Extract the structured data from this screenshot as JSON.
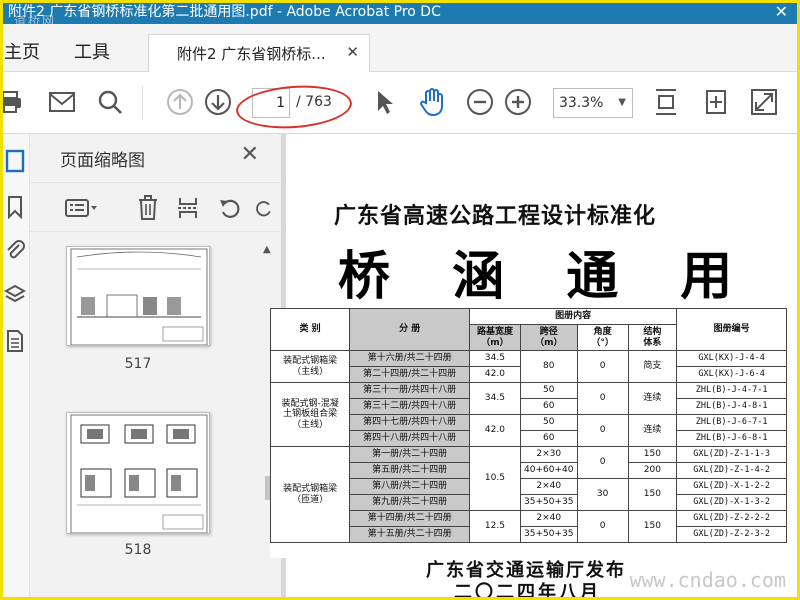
{
  "window": {
    "title": "附件2 广东省钢桥标准化第二批通用图.pdf - Adobe Acrobat Pro DC",
    "watermark": "道桥网"
  },
  "tabs": {
    "home": "主页",
    "tools": "工具",
    "document": "附件2 广东省钢桥标..."
  },
  "toolbar": {
    "current_page": "1",
    "total_pages": "/ 763",
    "zoom": "33.3%"
  },
  "thumbnails": {
    "title": "页面缩略图",
    "pages": [
      {
        "number": "517"
      },
      {
        "number": "518"
      }
    ]
  },
  "document": {
    "subtitle": "广东省高速公路工程设计标准化",
    "main_title": "桥 涵 通 用 图",
    "publisher": "广东省交通运输厅发布",
    "date": "二〇二四年八月",
    "watermark": "www.cndao.com"
  },
  "table": {
    "headers": {
      "category": "类 别",
      "volume": "分 册",
      "content_group": "图册内容",
      "width": "路基宽度\n（m）",
      "span": "跨径\n（m）",
      "angle": "角度\n（°）",
      "structure": "结构\n体系",
      "code": "图册编号"
    },
    "groups": [
      {
        "category": "装配式钢箱梁\n（主线）",
        "rows": [
          {
            "volume": "第十六册/共二十四册",
            "width": "34.5",
            "span": "80",
            "angle": "0",
            "structure": "简支",
            "code": "GXL(KX)-J-4-4"
          },
          {
            "volume": "第二十四册/共二十四册",
            "width": "42.0",
            "code": "GXL(KX)-J-6-4"
          }
        ]
      },
      {
        "category": "装配式钢-混凝\n土钢板组合梁\n（主线）",
        "rows": [
          {
            "volume": "第三十一册/共四十八册",
            "width": "34.5",
            "span": "50",
            "angle": "0",
            "structure": "连续",
            "code": "ZHL(B)-J-4-7-1"
          },
          {
            "volume": "第三十二册/共四十八册",
            "span": "60",
            "code": "ZHL(B)-J-4-8-1"
          },
          {
            "volume": "第四十七册/共四十八册",
            "width": "42.0",
            "span": "50",
            "angle": "0",
            "structure": "连续",
            "code": "ZHL(B)-J-6-7-1"
          },
          {
            "volume": "第四十八册/共四十八册",
            "span": "60",
            "code": "ZHL(B)-J-6-8-1"
          }
        ]
      },
      {
        "category": "装配式钢箱梁\n（匝道）",
        "rows": [
          {
            "volume": "第一册/共二十四册",
            "width": "10.5",
            "span": "2×30",
            "angle": "0",
            "structure": "150",
            "code": "GXL(ZD)-Z-1-1-3"
          },
          {
            "volume": "第五册/共二十四册",
            "span": "40+60+40",
            "structure": "200",
            "code": "GXL(ZD)-Z-1-4-2"
          },
          {
            "volume": "第八册/共二十四册",
            "span": "2×40",
            "angle": "30",
            "structure": "150",
            "code": "GXL(ZD)-X-1-2-2"
          },
          {
            "volume": "第九册/共二十四册",
            "span": "35+50+35",
            "code": "GXL(ZD)-X-1-3-2"
          },
          {
            "volume": "第十四册/共二十四册",
            "width": "12.5",
            "span": "2×40",
            "angle": "0",
            "structure": "150",
            "code": "GXL(ZD)-Z-2-2-2"
          },
          {
            "volume": "第十五册/共二十四册",
            "span": "35+50+35",
            "code": "GXL(ZD)-Z-2-3-2"
          }
        ]
      }
    ]
  },
  "colors": {
    "titlebar": "#1e7bb2",
    "frame": "#f2e000",
    "annotation_oval": "#d9302c"
  }
}
